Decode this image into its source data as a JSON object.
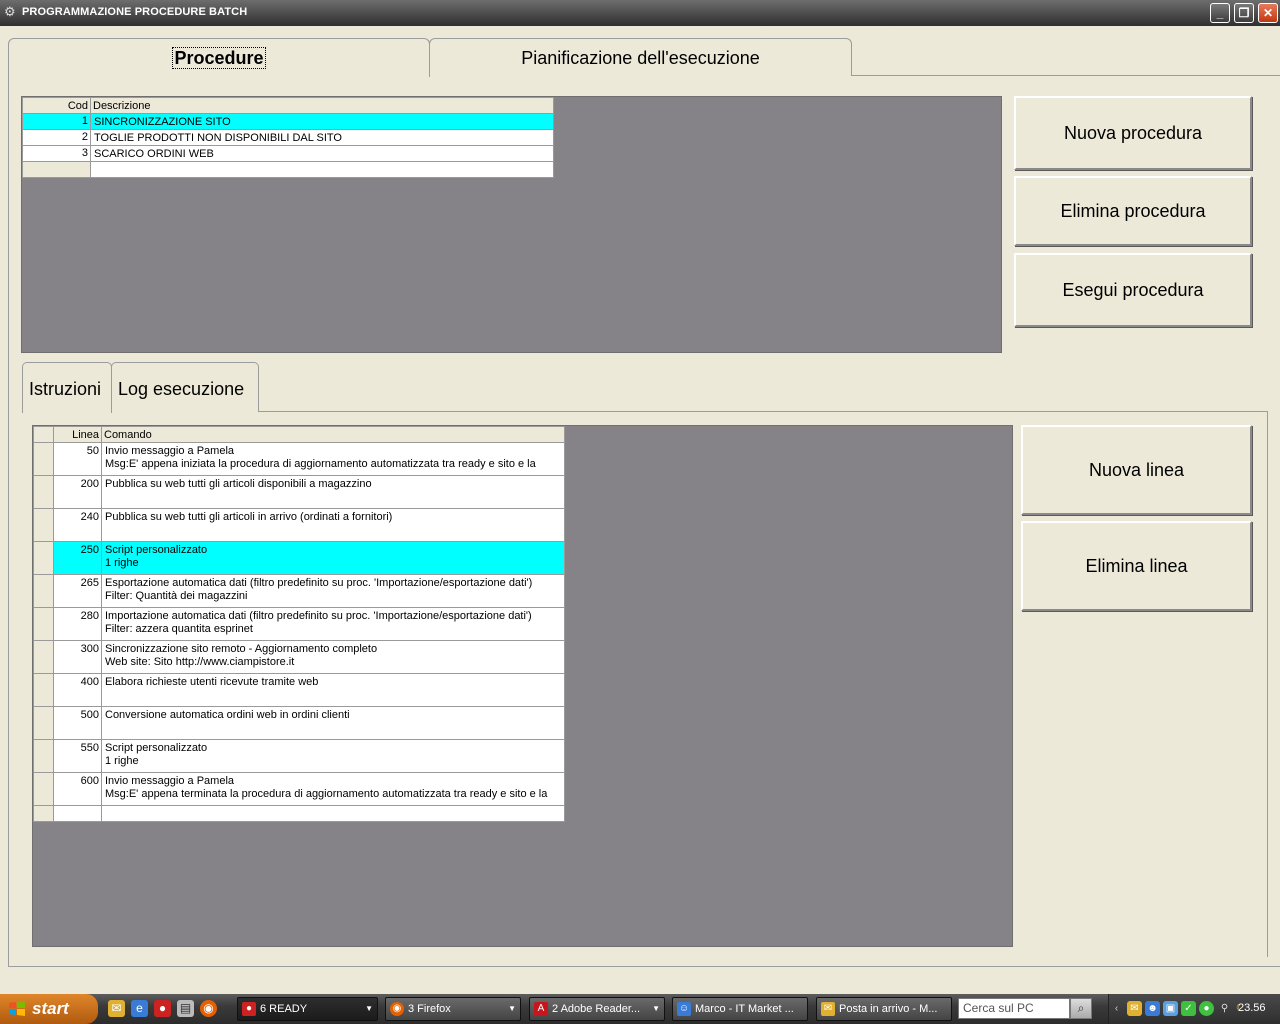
{
  "window": {
    "title": "PROGRAMMAZIONE PROCEDURE BATCH",
    "minimize": "_",
    "restore": "❐",
    "close": "✕"
  },
  "main_tabs": [
    {
      "label": "Procedure",
      "active": true
    },
    {
      "label": "Pianificazione dell'esecuzione",
      "active": false
    }
  ],
  "procedures": {
    "columns": [
      "Cod",
      "Descrizione"
    ],
    "rows": [
      {
        "cod": "1",
        "desc": "SINCRONIZZAZIONE SITO",
        "selected": true
      },
      {
        "cod": "2",
        "desc": "TOGLIE PRODOTTI NON DISPONIBILI DAL SITO",
        "selected": false
      },
      {
        "cod": "3",
        "desc": "SCARICO ORDINI WEB",
        "selected": false
      }
    ]
  },
  "procedure_buttons": {
    "new": "Nuova procedura",
    "delete": "Elimina procedura",
    "run": "Esegui procedura"
  },
  "sub_tabs": [
    {
      "label": "Istruzioni",
      "active": true
    },
    {
      "label": "Log esecuzione",
      "active": false
    }
  ],
  "instructions": {
    "columns": [
      "Linea",
      "Comando"
    ],
    "rows": [
      {
        "linea": "50",
        "line1": "Invio messaggio a Pamela",
        "line2": "Msg:E' appena iniziata la procedura di aggiornamento automatizzata tra ready e sito e la",
        "selected": false
      },
      {
        "linea": "200",
        "line1": "Pubblica su web tutti gli articoli disponibili a magazzino",
        "line2": "",
        "selected": false
      },
      {
        "linea": "240",
        "line1": "Pubblica su web tutti gli articoli in arrivo (ordinati a fornitori)",
        "line2": "",
        "selected": false
      },
      {
        "linea": "250",
        "line1": "Script personalizzato",
        "line2": "1 righe",
        "selected": true
      },
      {
        "linea": "265",
        "line1": "Esportazione automatica dati (filtro predefinito su proc. 'Importazione/esportazione dati')",
        "line2": "Filter: Quantità dei magazzini",
        "selected": false
      },
      {
        "linea": "280",
        "line1": "Importazione automatica dati (filtro predefinito su proc. 'Importazione/esportazione dati')",
        "line2": "Filter: azzera quantita esprinet",
        "selected": false
      },
      {
        "linea": "300",
        "line1": "Sincronizzazione sito remoto - Aggiornamento completo",
        "line2": "Web site: Sito http://www.ciampistore.it",
        "selected": false
      },
      {
        "linea": "400",
        "line1": "Elabora richieste utenti ricevute tramite web",
        "line2": "",
        "selected": false
      },
      {
        "linea": "500",
        "line1": "Conversione automatica ordini web in ordini clienti",
        "line2": "",
        "selected": false
      },
      {
        "linea": "550",
        "line1": "Script personalizzato",
        "line2": "1 righe",
        "selected": false
      },
      {
        "linea": "600",
        "line1": "Invio messaggio a Pamela",
        "line2": "Msg:E' appena terminata la procedura di aggiornamento automatizzata tra ready e sito e la",
        "selected": false
      }
    ]
  },
  "instruction_buttons": {
    "new": "Nuova linea",
    "delete": "Elimina linea"
  },
  "taskbar": {
    "start": "start",
    "tasks": [
      {
        "label": "6 READY",
        "count": "6",
        "name": "READY",
        "icon": "strawberry-icon",
        "color": "#cc2222"
      },
      {
        "label": "3 Firefox",
        "count": "3",
        "name": "Firefox",
        "icon": "firefox-icon",
        "color": "#e66000"
      },
      {
        "label": "2 Adobe Reader...",
        "count": "2",
        "name": "Adobe Reader...",
        "icon": "adobe-icon",
        "color": "#c4161c"
      },
      {
        "label": "Marco - IT Market ...",
        "icon": "messenger-icon",
        "color": "#3a7bd5"
      },
      {
        "label": "Posta in arrivo - M...",
        "icon": "mail-icon",
        "color": "#e0b030"
      }
    ],
    "search_placeholder": "Cerca sul PC",
    "clock": "23.56"
  },
  "colors": {
    "selection": "#00ffff",
    "grid_background": "#858388",
    "window_face": "#ece9d8"
  }
}
